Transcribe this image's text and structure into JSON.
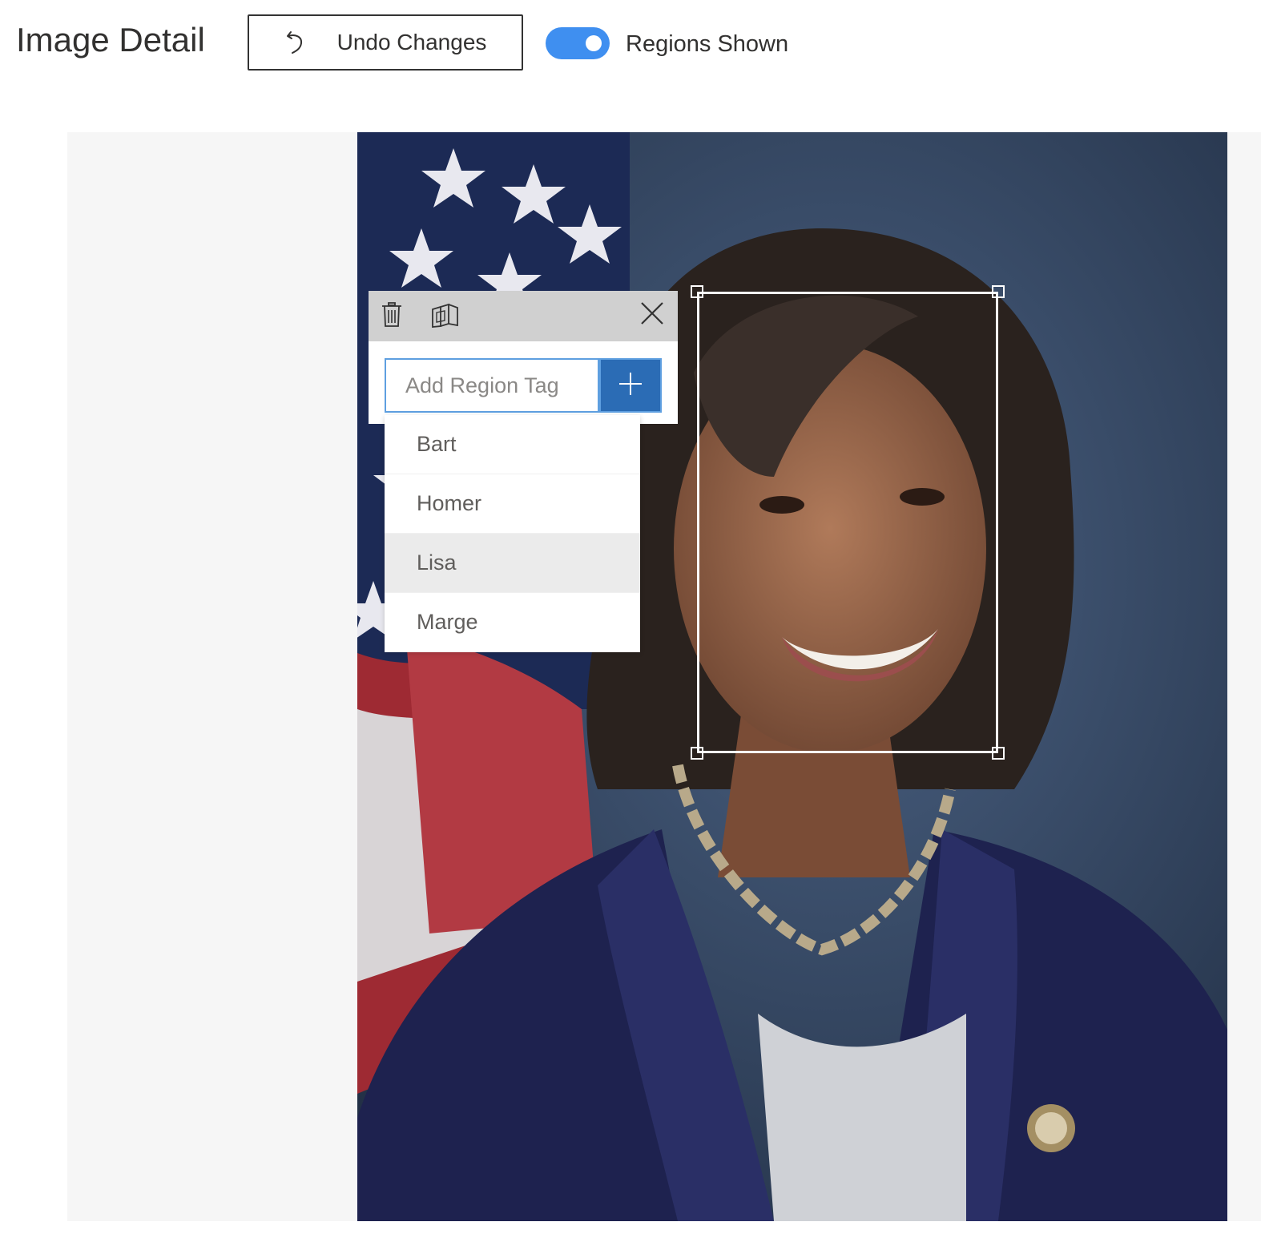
{
  "header": {
    "title": "Image Detail",
    "undo_label": "Undo Changes",
    "undo_icon": "undo-icon",
    "regions_toggle": {
      "label": "Regions Shown",
      "on": true,
      "color": "#3f8ff0"
    }
  },
  "region_panel": {
    "toolbar": {
      "delete_icon": "trash-icon",
      "copy_icon": "copy-regions-icon",
      "close_icon": "close-icon"
    },
    "tag_input": {
      "placeholder": "Add Region Tag",
      "value": ""
    },
    "add_icon": "plus-icon",
    "accent": "#2b6cb5"
  },
  "tag_suggestions": {
    "items": [
      {
        "label": "Bart"
      },
      {
        "label": "Homer"
      },
      {
        "label": "Lisa"
      },
      {
        "label": "Marge"
      }
    ],
    "highlighted": "Lisa"
  },
  "image": {
    "subject": "portrait-photo"
  }
}
